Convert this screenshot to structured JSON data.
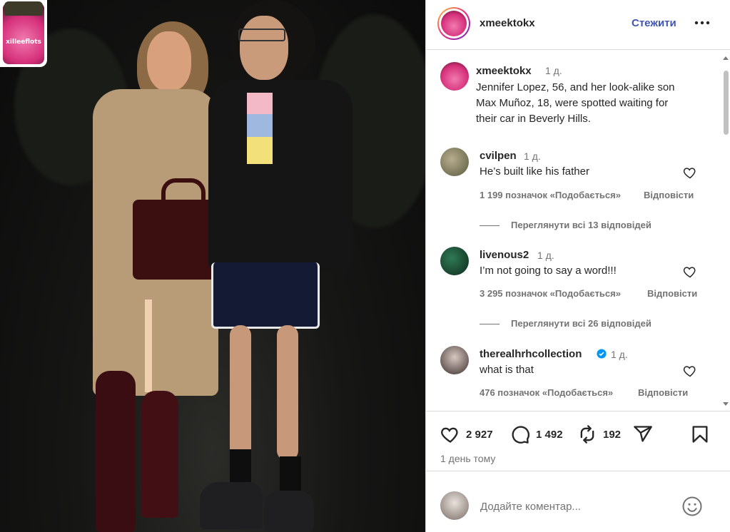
{
  "post": {
    "sticker_text": "xilleeflots"
  },
  "header": {
    "username": "xmeektokx",
    "follow_label": "Стежити",
    "more_label": "•••"
  },
  "caption": {
    "username": "xmeektokx",
    "time": "1 д.",
    "text": "Jennifer Lopez, 56, and her look-alike son Max Muñoz, 18, were spotted waiting for their car in Beverly Hills."
  },
  "comments": [
    {
      "username": "cvilpen",
      "time": "1 д.",
      "text": "He’s built like his father",
      "likes": "1 199 позначок «Подобається»",
      "reply_label": "Відповісти",
      "view_replies": "Переглянути всі 13 відповідей",
      "verified": false
    },
    {
      "username": "livenous2",
      "time": "1 д.",
      "text": "I’m not going to say a word!!!",
      "likes": "3 295 позначок «Подобається»",
      "reply_label": "Відповісти",
      "view_replies": "Переглянути всі 26 відповідей",
      "verified": false
    },
    {
      "username": "therealhrhcollection",
      "time": "1 д.",
      "text": "what is that",
      "likes": "476 позначок «Подобається»",
      "reply_label": "Відповісти",
      "verified": true
    }
  ],
  "actions": {
    "likes_count": "2 927",
    "comments_count": "1 492",
    "reposts_count": "192"
  },
  "time_ago": "1 день тому",
  "add_comment": {
    "placeholder": "Додайте коментар..."
  },
  "colors": {
    "accent": "#4054b2",
    "verified": "#0095f6",
    "text": "#262626",
    "muted": "#737373"
  },
  "icons": [
    "heart-icon",
    "comment-icon",
    "repost-icon",
    "share-icon",
    "bookmark-icon",
    "emoji-icon",
    "verified-icon",
    "more-icon"
  ]
}
